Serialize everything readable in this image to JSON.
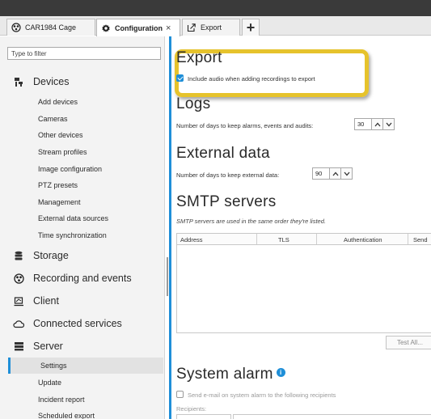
{
  "tabs": [
    {
      "label": "CAR1984 Cage",
      "icon": "camera-network-icon"
    },
    {
      "label": "Configuration",
      "icon": "gear-icon",
      "close": "×"
    },
    {
      "label": "Export",
      "icon": "export-icon"
    },
    {
      "label": "+",
      "icon": "plus-icon"
    }
  ],
  "sidebar": {
    "filter_placeholder": "Type to filter",
    "sections": {
      "devices": "Devices",
      "storage": "Storage",
      "recording": "Recording and events",
      "client": "Client",
      "connected": "Connected services",
      "server": "Server"
    },
    "device_items": [
      "Add devices",
      "Cameras",
      "Other devices",
      "Stream profiles",
      "Image configuration",
      "PTZ presets",
      "Management",
      "External data sources",
      "Time synchronization"
    ],
    "server_items": [
      "Settings",
      "Update",
      "Incident report",
      "Scheduled export"
    ],
    "active_item": "Settings"
  },
  "main": {
    "export": {
      "title": "Export",
      "include_audio_label": "Include audio when adding recordings to export",
      "include_audio_checked": true
    },
    "logs": {
      "title": "Logs",
      "days_label": "Number of days to keep alarms, events and audits:",
      "days_value": "30"
    },
    "external": {
      "title": "External data",
      "days_label": "Number of days to keep external data:",
      "days_value": "90"
    },
    "smtp": {
      "title": "SMTP servers",
      "note": "SMTP servers are used in the same order they're listed.",
      "columns": [
        "Address",
        "TLS",
        "Authentication",
        "Send"
      ],
      "test_button": "Test All..."
    },
    "system_alarm": {
      "title": "System alarm",
      "info": "i",
      "send_email_label": "Send e-mail on system alarm to the following recipients",
      "send_email_checked": false,
      "recipients_label": "Recipients:"
    }
  },
  "colors": {
    "accent": "#1f8fd8",
    "highlight": "#e6c32c",
    "sidebar_bg": "#f3f3f3",
    "topbar": "#3a3a3a"
  }
}
